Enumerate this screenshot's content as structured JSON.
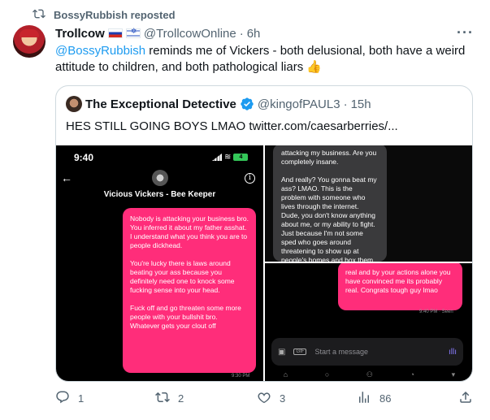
{
  "repost": {
    "label": "BossyRubbish reposted"
  },
  "tweet": {
    "name": "Trollcow",
    "handle": "@TrollcowOnline",
    "dot": "·",
    "time": "6h",
    "mention": "@BossyRubbish",
    "text_line": " reminds me of Vickers - both delusional, both have a weird attitude to children, and both pathological liars 👍"
  },
  "quote": {
    "name": "The Exceptional Detective",
    "handle": "@kingofPAUL3",
    "dot": "·",
    "time": "15h",
    "text": "HES STILL GOING BOYS LMAO  twitter.com/caesarberries/..."
  },
  "screenshot_left": {
    "clock": "9:40",
    "battery": "4",
    "contact": "Vicious Vickers - Bee Keeper",
    "paragraphs": [
      "Nobody is attacking your business bro. You inferred it about my father asshat. I understand what you think you are to people dickhead.",
      "You're lucky there is laws around beating your ass because you definitely need one to knock some fucking sense into your head.",
      "Fuck off and go threaten some more people with your bullshit bro. Whatever gets your clout off"
    ],
    "timestamp": "9:30 PM"
  },
  "screenshot_rt": {
    "paragraphs": [
      "attacking my business. Are you completely insane.",
      "And really? You gonna beat my ass? LMAO. This is the problem with someone who lives through the internet. Dude, you don't know anything about me, or my ability to fight. Just because I'm not some sped who goes around threatening to show up at people's homes and box them"
    ]
  },
  "screenshot_rb": {
    "bubble": "real and by your actions alone you have convinced me its probably real. Congrats tough guy lmao",
    "timestamp": "9:40 PM · Seen",
    "placeholder": "Start a message",
    "gif": "GIF"
  },
  "actions": {
    "replies": "1",
    "reposts": "2",
    "likes": "3",
    "views": "86"
  },
  "colors": {
    "accent": "#1d9bf0",
    "imessage_pink": "#ff2d7a",
    "muted": "#536471"
  }
}
